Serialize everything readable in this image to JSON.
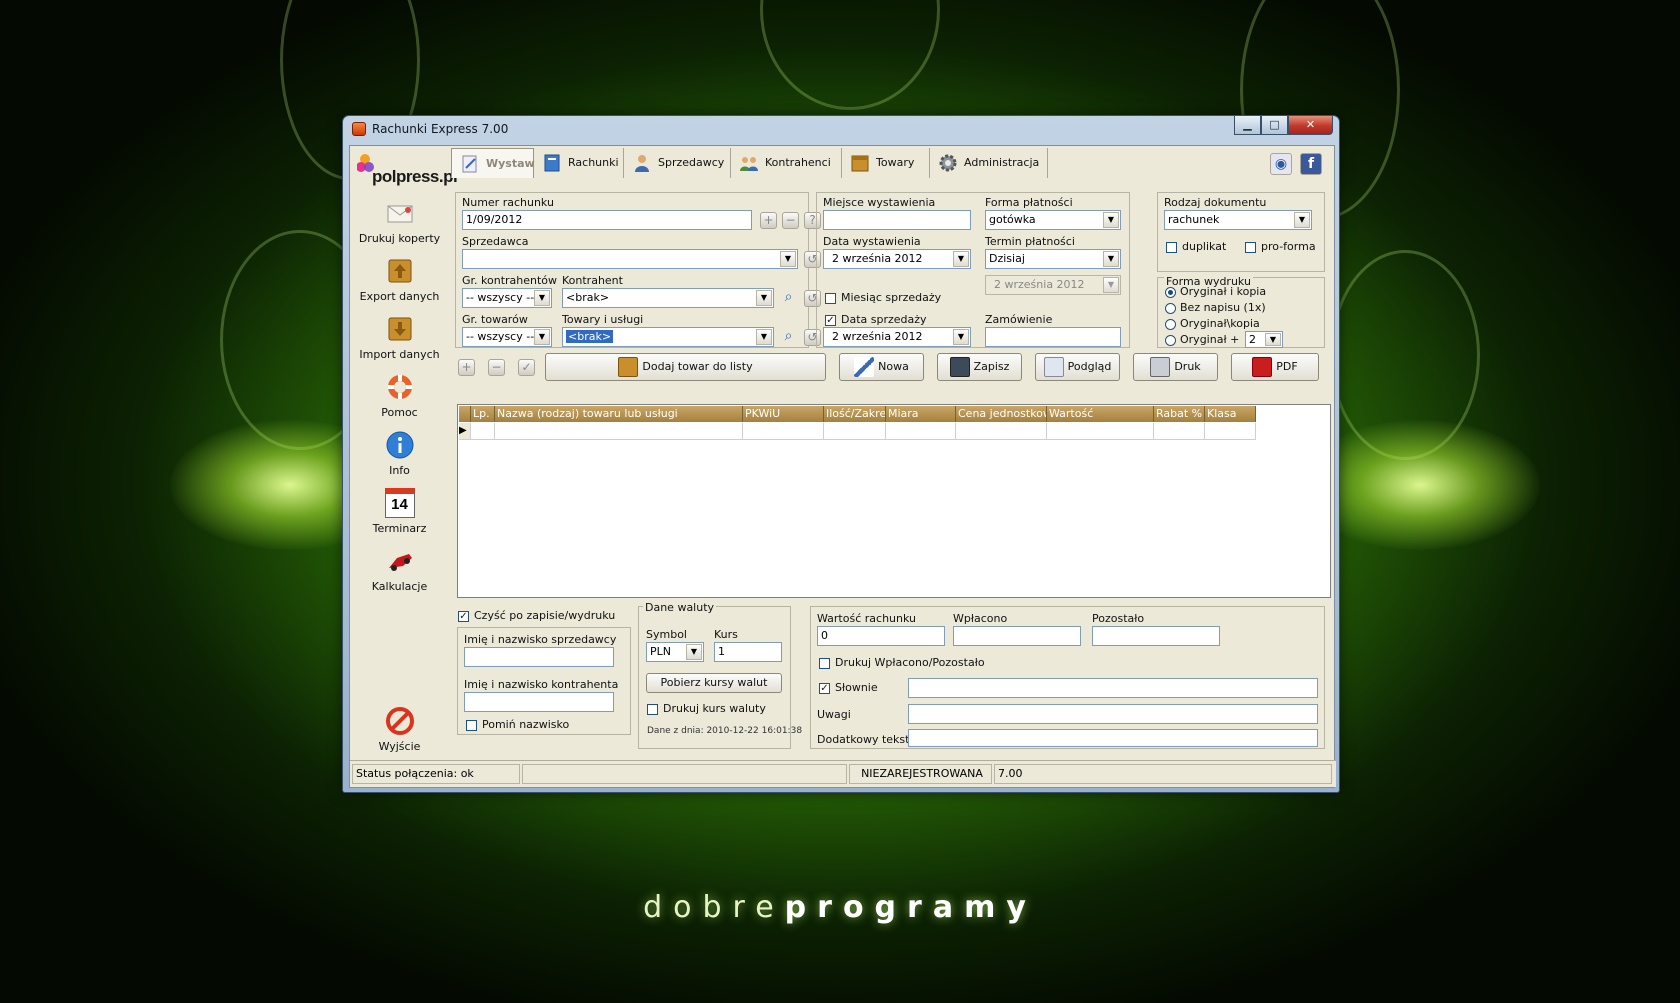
{
  "window": {
    "title": "Rachunki Express 7.00",
    "min_glyph": "▁",
    "max_glyph": "□",
    "close_glyph": "✕"
  },
  "logo": {
    "text": "polpress.pl"
  },
  "sidebar": {
    "items": [
      {
        "label": "Drukuj koperty",
        "icon": "envelope-icon"
      },
      {
        "label": "Export danych",
        "icon": "export-arrow-icon"
      },
      {
        "label": "Import danych",
        "icon": "import-arrow-icon"
      },
      {
        "label": "Pomoc",
        "icon": "lifebuoy-icon"
      },
      {
        "label": "Info",
        "icon": "info-icon"
      },
      {
        "label": "Terminarz",
        "icon": "calendar-icon",
        "badge": "14"
      },
      {
        "label": "Kalkulacje",
        "icon": "race-car-icon"
      },
      {
        "label": "Wyjście",
        "icon": "no-entry-icon"
      }
    ]
  },
  "tabs": [
    {
      "label": "Wystaw",
      "active": true
    },
    {
      "label": "Rachunki"
    },
    {
      "label": "Sprzedawcy"
    },
    {
      "label": "Kontrahenci"
    },
    {
      "label": "Towary"
    },
    {
      "label": "Administracja"
    }
  ],
  "form": {
    "numer_label": "Numer rachunku",
    "numer_value": "1/09/2012",
    "sprzedawca_label": "Sprzedawca",
    "sprzedawca_value": "",
    "gr_kontr_label": "Gr. kontrahentów",
    "gr_kontr_value": "-- wszyscy --",
    "kontrahent_label": "Kontrahent",
    "kontrahent_value": "<brak>",
    "gr_tow_label": "Gr. towarów",
    "gr_tow_value": "-- wszyscy --",
    "towary_label": "Towary i usługi",
    "towary_value": "<brak>",
    "miejsce_label": "Miejsce wystawienia",
    "miejsce_value": "",
    "data_wyst_label": "Data wystawienia",
    "data_wyst_value": "2   września   2012",
    "miesiac_label": "Miesiąc sprzedaży",
    "miesiac_checked": false,
    "data_sprz_label": "Data sprzedaży",
    "data_sprz_checked": true,
    "data_sprz_value": "2   września   2012",
    "forma_label": "Forma płatności",
    "forma_value": "gotówka",
    "termin_label": "Termin płatności",
    "termin_value": "Dzisiaj",
    "termin_date": "2   września   2012",
    "zamowienie_label": "Zamówienie",
    "zamowienie_value": "",
    "rodzaj_label": "Rodzaj dokumentu",
    "rodzaj_value": "rachunek",
    "duplikat_label": "duplikat",
    "proforma_label": "pro-forma",
    "forma_wydruku_label": "Forma wydruku",
    "wydruk_options": [
      "Oryginał i kopia",
      "Bez napisu (1x)",
      "Oryginał\\kopia",
      "Oryginał +"
    ],
    "wydruk_selected": 0,
    "wydruk_count": "2"
  },
  "toolbar": {
    "add_item_label": "Dodaj towar do listy",
    "nowa_label": "Nowa",
    "zapisz_label": "Zapisz",
    "podglad_label": "Podgląd",
    "druk_label": "Druk",
    "pdf_label": "PDF"
  },
  "grid": {
    "columns": [
      "Lp.",
      "Nazwa (rodzaj) towaru lub usługi",
      "PKWiU",
      "Ilość/Zakres",
      "Miara",
      "Cena jednostkowa",
      "Wartość",
      "Rabat %",
      "Klasa"
    ],
    "row_marker": "▶"
  },
  "bottom": {
    "czysc_label": "Czyść po zapisie/wydruku",
    "czysc_checked": true,
    "imie_sprzed_label": "Imię i nazwisko sprzedawcy",
    "imie_kontr_label": "Imię i nazwisko kontrahenta",
    "pomin_label": "Pomiń nazwisko",
    "waluta_title": "Dane waluty",
    "symbol_label": "Symbol",
    "symbol_value": "PLN",
    "kurs_label": "Kurs",
    "kurs_value": "1",
    "pobierz_label": "Pobierz kursy walut",
    "drukuj_kurs_label": "Drukuj kurs waluty",
    "dane_z_dnia": "Dane z dnia: 2010-12-22 16:01:38",
    "wartosc_label": "Wartość rachunku",
    "wartosc_value": "0",
    "wplacono_label": "Wpłacono",
    "pozostalo_label": "Pozostało",
    "drukuj_wp_label": "Drukuj  Wpłacono/Pozostało",
    "slownie_label": "Słownie",
    "slownie_checked": true,
    "uwagi_label": "Uwagi",
    "dodatkowy_label": "Dodatkowy tekst"
  },
  "status": {
    "connection": "Status połączenia: ok",
    "reg": "NIEZAREJESTROWANA",
    "version": "7.00"
  },
  "branding": {
    "light": "dobre",
    "bold": "programy"
  }
}
